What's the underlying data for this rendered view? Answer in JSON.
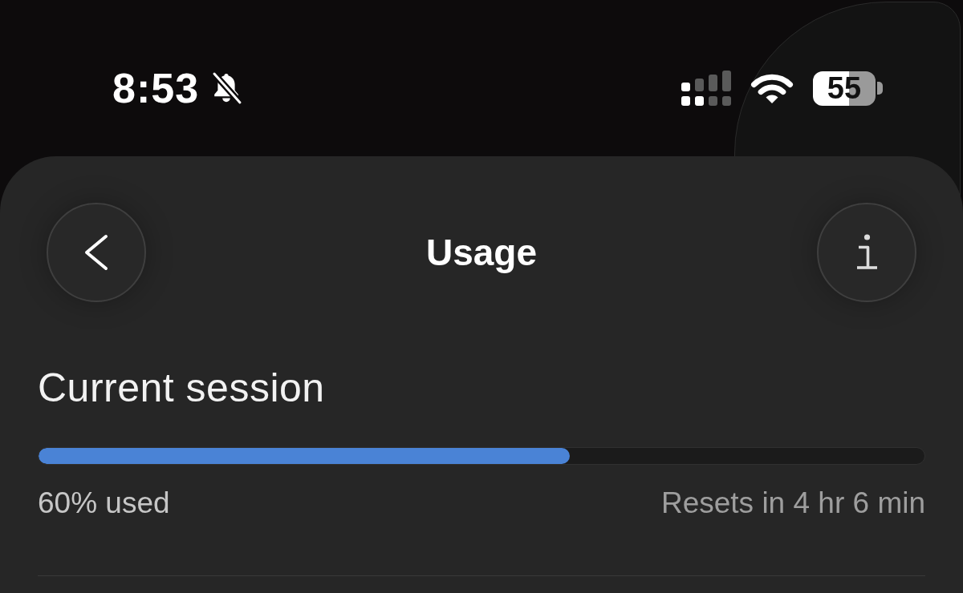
{
  "status_bar": {
    "time": "8:53",
    "battery": "55"
  },
  "header": {
    "title": "Usage"
  },
  "session": {
    "title": "Current session",
    "level": 0.6,
    "used": "60% used",
    "resets": "Resets in 4 hr 6 min"
  }
}
